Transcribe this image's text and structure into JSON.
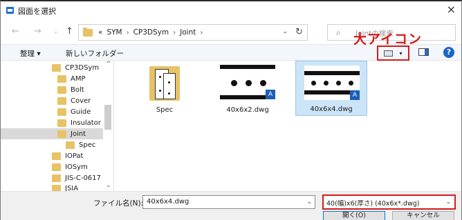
{
  "window": {
    "title": "図面を選択",
    "close_glyph": "×"
  },
  "nav": {
    "back": "←",
    "forward": "→",
    "up": "↑",
    "refresh": "↻"
  },
  "address": {
    "breadcrumb": [
      "«",
      "SYM",
      "›",
      "CP3DSym",
      "›",
      "Joint",
      "›"
    ],
    "dropdown": "⌄"
  },
  "search": {
    "placeholder": "Jointの検索"
  },
  "toolbar": {
    "organize": "整理 ▾",
    "new_folder": "新しいフォルダー",
    "view_dropdown": "▾",
    "help": "?"
  },
  "annotation": {
    "label": "大アイコン",
    "color": "#d61a1a"
  },
  "sidebar": {
    "items": [
      {
        "label": "CP3DSym",
        "indent": 1,
        "selected": false
      },
      {
        "label": "AMP",
        "indent": 2,
        "selected": false
      },
      {
        "label": "Bolt",
        "indent": 2,
        "selected": false
      },
      {
        "label": "Cover",
        "indent": 2,
        "selected": false
      },
      {
        "label": "Guide",
        "indent": 2,
        "selected": false
      },
      {
        "label": "Insulator",
        "indent": 2,
        "selected": false
      },
      {
        "label": "Joint",
        "indent": 2,
        "selected": true
      },
      {
        "label": "Spec",
        "indent": 3,
        "selected": false
      },
      {
        "label": "IOPat",
        "indent": 1,
        "selected": false
      },
      {
        "label": "IOSym",
        "indent": 1,
        "selected": false
      },
      {
        "label": "JIS-C-0617",
        "indent": 1,
        "selected": false
      },
      {
        "label": "JSIA",
        "indent": 1,
        "selected": false
      }
    ],
    "scroll_up": "^",
    "scroll_down": "⌄"
  },
  "files": [
    {
      "name": "Spec",
      "type": "folder",
      "selected": false
    },
    {
      "name": "40x6x2.dwg",
      "type": "dwg",
      "holes": 3,
      "selected": false
    },
    {
      "name": "40x6x4.dwg",
      "type": "dwg",
      "holes": 4,
      "selected": true
    }
  ],
  "bottom": {
    "filename_label": "ファイル名(N):",
    "filename_value": "40x6x4.dwg",
    "filter_value": "40(幅)x6(厚さ) (40x6x*.dwg)",
    "open_label": "開く(O)",
    "cancel_label": "キャンセル"
  },
  "colors": {
    "accent": "#0078d7",
    "selection": "#cce4f7",
    "folder": "#e8c266",
    "annotation": "#d61a1a"
  }
}
